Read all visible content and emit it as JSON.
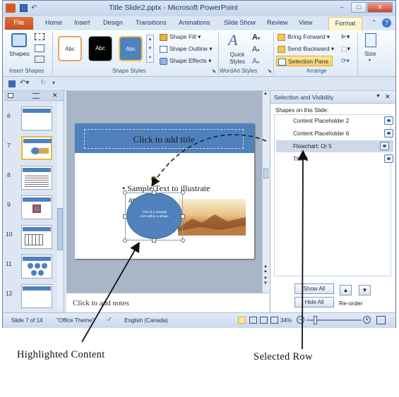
{
  "window": {
    "title": "Title Slide2.pptx - Microsoft PowerPoint",
    "btn_min": "–",
    "btn_max": "□",
    "btn_close": "✕"
  },
  "tabs": {
    "file": "File",
    "items": [
      "Home",
      "Insert",
      "Design",
      "Transitions",
      "Animations",
      "Slide Show",
      "Review",
      "View"
    ],
    "format": "Format",
    "help": "?"
  },
  "ribbon": {
    "shapes_label": "Shapes",
    "insert_shapes_group": "Insert Shapes",
    "style_boxes": [
      "Abc",
      "Abc",
      "Abc"
    ],
    "shape_fill": "Shape Fill",
    "shape_outline": "Shape Outline",
    "shape_effects": "Shape Effects",
    "shape_styles_group": "Shape Styles",
    "quick_styles": "Quick Styles",
    "wordart_group": "WordArt Styles",
    "bring_forward": "Bring Forward",
    "send_backward": "Send Backward",
    "selection_pane": "Selection Pane",
    "arrange_group": "Arrange",
    "size_label": "Size"
  },
  "thumbnails": [
    "6",
    "7",
    "8",
    "9",
    "10",
    "11",
    "12"
  ],
  "slide": {
    "title_placeholder": "Click to add title",
    "bullet_line1": "Sample Text to illustrate",
    "bullet_line2": "arrangement",
    "circle_text_1": "This is a sample",
    "circle_text_2": "text within a shape"
  },
  "notes": {
    "placeholder": "Click to add notes"
  },
  "selection_pane": {
    "header": "Selection and Visibility",
    "subheader": "Shapes on this Slide:",
    "rows": [
      "Content Placeholder 2",
      "Content Placeholder 6",
      "Flowchart: Or 5",
      "Title 1"
    ],
    "selected_index": 2,
    "show_all": "Show All",
    "hide_all": "Hide All",
    "reorder": "Re-order",
    "up": "▲",
    "down": "▼"
  },
  "status_bar": {
    "slide_info": "Slide 7 of 14",
    "theme": "\"Office Theme\"",
    "language": "English (Canada)",
    "zoom": "34%"
  },
  "captions": {
    "left": "Highlighted Content",
    "right": "Selected Row"
  }
}
